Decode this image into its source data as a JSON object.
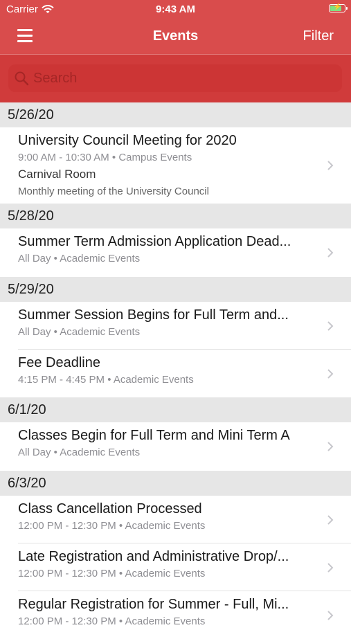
{
  "status_bar": {
    "carrier": "Carrier",
    "time": "9:43 AM"
  },
  "nav": {
    "title": "Events",
    "filter_label": "Filter"
  },
  "search": {
    "placeholder": "Search"
  },
  "colors": {
    "header": "#d94c4c",
    "search_bar": "#d03b3b",
    "section_bg": "#e6e6e6"
  },
  "sections": [
    {
      "date": "5/26/20",
      "events": [
        {
          "title": "University Council Meeting for 2020",
          "time": "9:00 AM - 10:30 AM",
          "category": "Campus Events",
          "location": "Carnival Room",
          "description": "Monthly meeting of the University Council"
        }
      ]
    },
    {
      "date": "5/28/20",
      "events": [
        {
          "title": "Summer Term Admission Application Dead...",
          "time": "All Day",
          "category": "Academic Events"
        }
      ]
    },
    {
      "date": "5/29/20",
      "events": [
        {
          "title": "Summer Session Begins for Full Term and...",
          "time": "All Day",
          "category": "Academic Events"
        },
        {
          "title": "Fee Deadline",
          "time": "4:15 PM - 4:45 PM",
          "category": "Academic Events"
        }
      ]
    },
    {
      "date": "6/1/20",
      "events": [
        {
          "title": "Classes Begin for Full Term and Mini Term A",
          "time": "All Day",
          "category": "Academic Events"
        }
      ]
    },
    {
      "date": "6/3/20",
      "events": [
        {
          "title": "Class Cancellation Processed",
          "time": "12:00 PM - 12:30 PM",
          "category": "Academic Events"
        },
        {
          "title": "Late Registration and Administrative Drop/...",
          "time": "12:00 PM - 12:30 PM",
          "category": "Academic Events"
        },
        {
          "title": "Regular Registration for Summer - Full, Mi...",
          "time": "12:00 PM - 12:30 PM",
          "category": "Academic Events"
        }
      ]
    }
  ]
}
